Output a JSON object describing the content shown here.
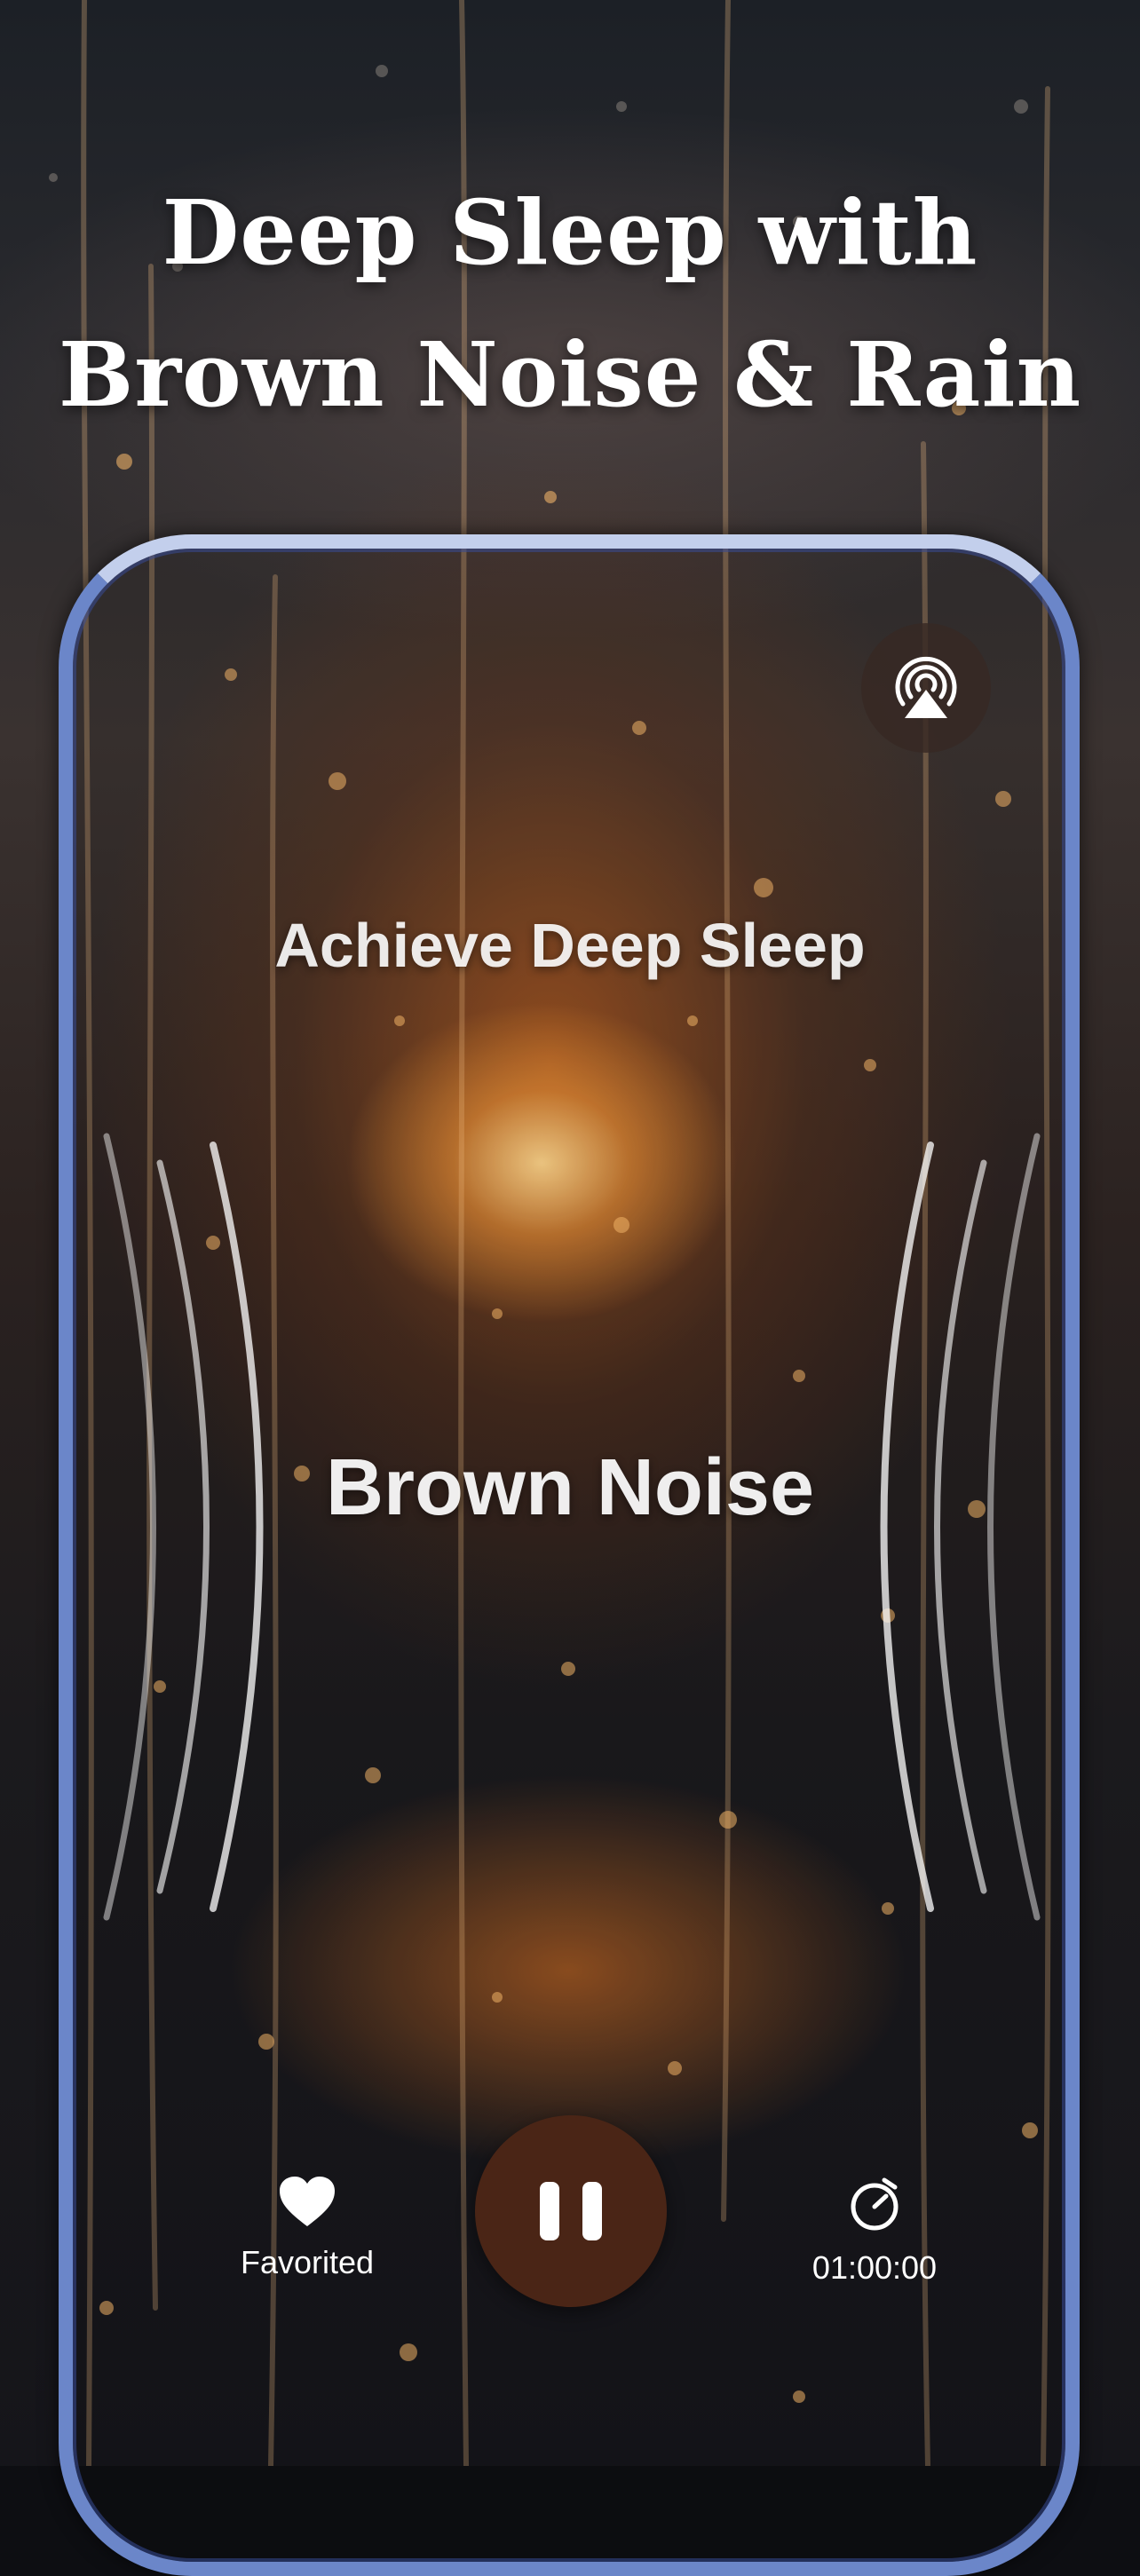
{
  "headline": {
    "line1": "Deep Sleep with",
    "line2": "Brown Noise & Rain"
  },
  "player": {
    "subtitle": "Achieve Deep Sleep",
    "track_title": "Brown Noise",
    "favorite_label": "Favorited",
    "timer_value": "01:00:00",
    "state": "playing"
  },
  "icons": {
    "cast": "airplay-icon",
    "favorite": "heart-icon",
    "play_pause": "pause-icon",
    "timer": "timer-icon"
  },
  "colors": {
    "frame": "#6b86c9",
    "play_button": "#4a2516",
    "text": "#ffffff"
  }
}
